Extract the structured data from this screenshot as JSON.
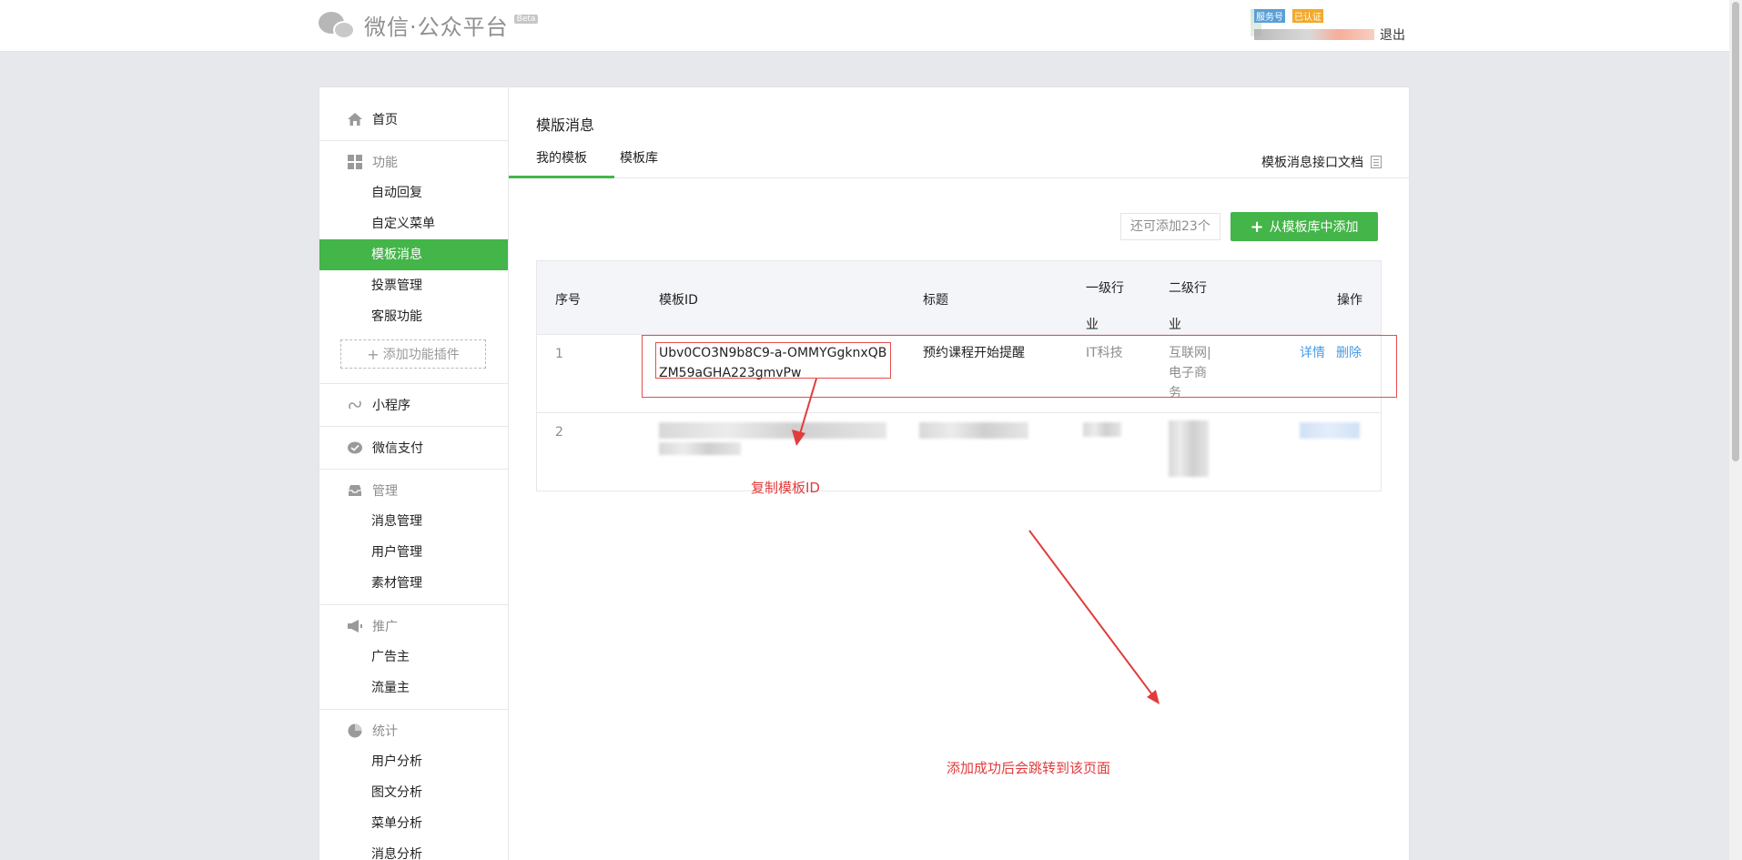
{
  "header": {
    "brand": "微信·公众平台",
    "beta": "Beta",
    "account_tag_service": "服务号",
    "account_tag_verified": "已认证",
    "logout": "退出"
  },
  "sidebar": {
    "home": "首页",
    "group_function": "功能",
    "function_items": [
      "自动回复",
      "自定义菜单",
      "模板消息",
      "投票管理",
      "客服功能"
    ],
    "add_plugin": "添加功能插件",
    "mini_program": "小程序",
    "wechat_pay": "微信支付",
    "group_manage": "管理",
    "manage_items": [
      "消息管理",
      "用户管理",
      "素材管理"
    ],
    "group_promote": "推广",
    "promote_items": [
      "广告主",
      "流量主"
    ],
    "group_stats": "统计",
    "stats_items": [
      "用户分析",
      "图文分析",
      "菜单分析",
      "消息分析"
    ]
  },
  "main": {
    "title": "模版消息",
    "tabs": [
      "我的模板",
      "模板库"
    ],
    "doc_link": "模板消息接口文档",
    "quota": "还可添加23个",
    "add_button": "从模板库中添加",
    "table": {
      "headers": [
        "序号",
        "模板ID",
        "标题",
        "一级行业",
        "二级行业",
        "操作"
      ],
      "rows": [
        {
          "index": "1",
          "template_id": "Ubv0CO3N9b8C9-a-OMMYGgknxQBZM59aGHA223gmvPw",
          "title": "预约课程开始提醒",
          "industry1": "IT科技",
          "industry2": "互联网|电子商务",
          "action_detail": "详情",
          "action_delete": "删除"
        },
        {
          "index": "2"
        }
      ]
    }
  },
  "annotations": {
    "copy_id": "复制模板ID",
    "redirect_note": "添加成功后会跳转到该页面",
    "color": "#e23b3b"
  },
  "colors": {
    "accent": "#44b549",
    "link": "#459ae9"
  }
}
